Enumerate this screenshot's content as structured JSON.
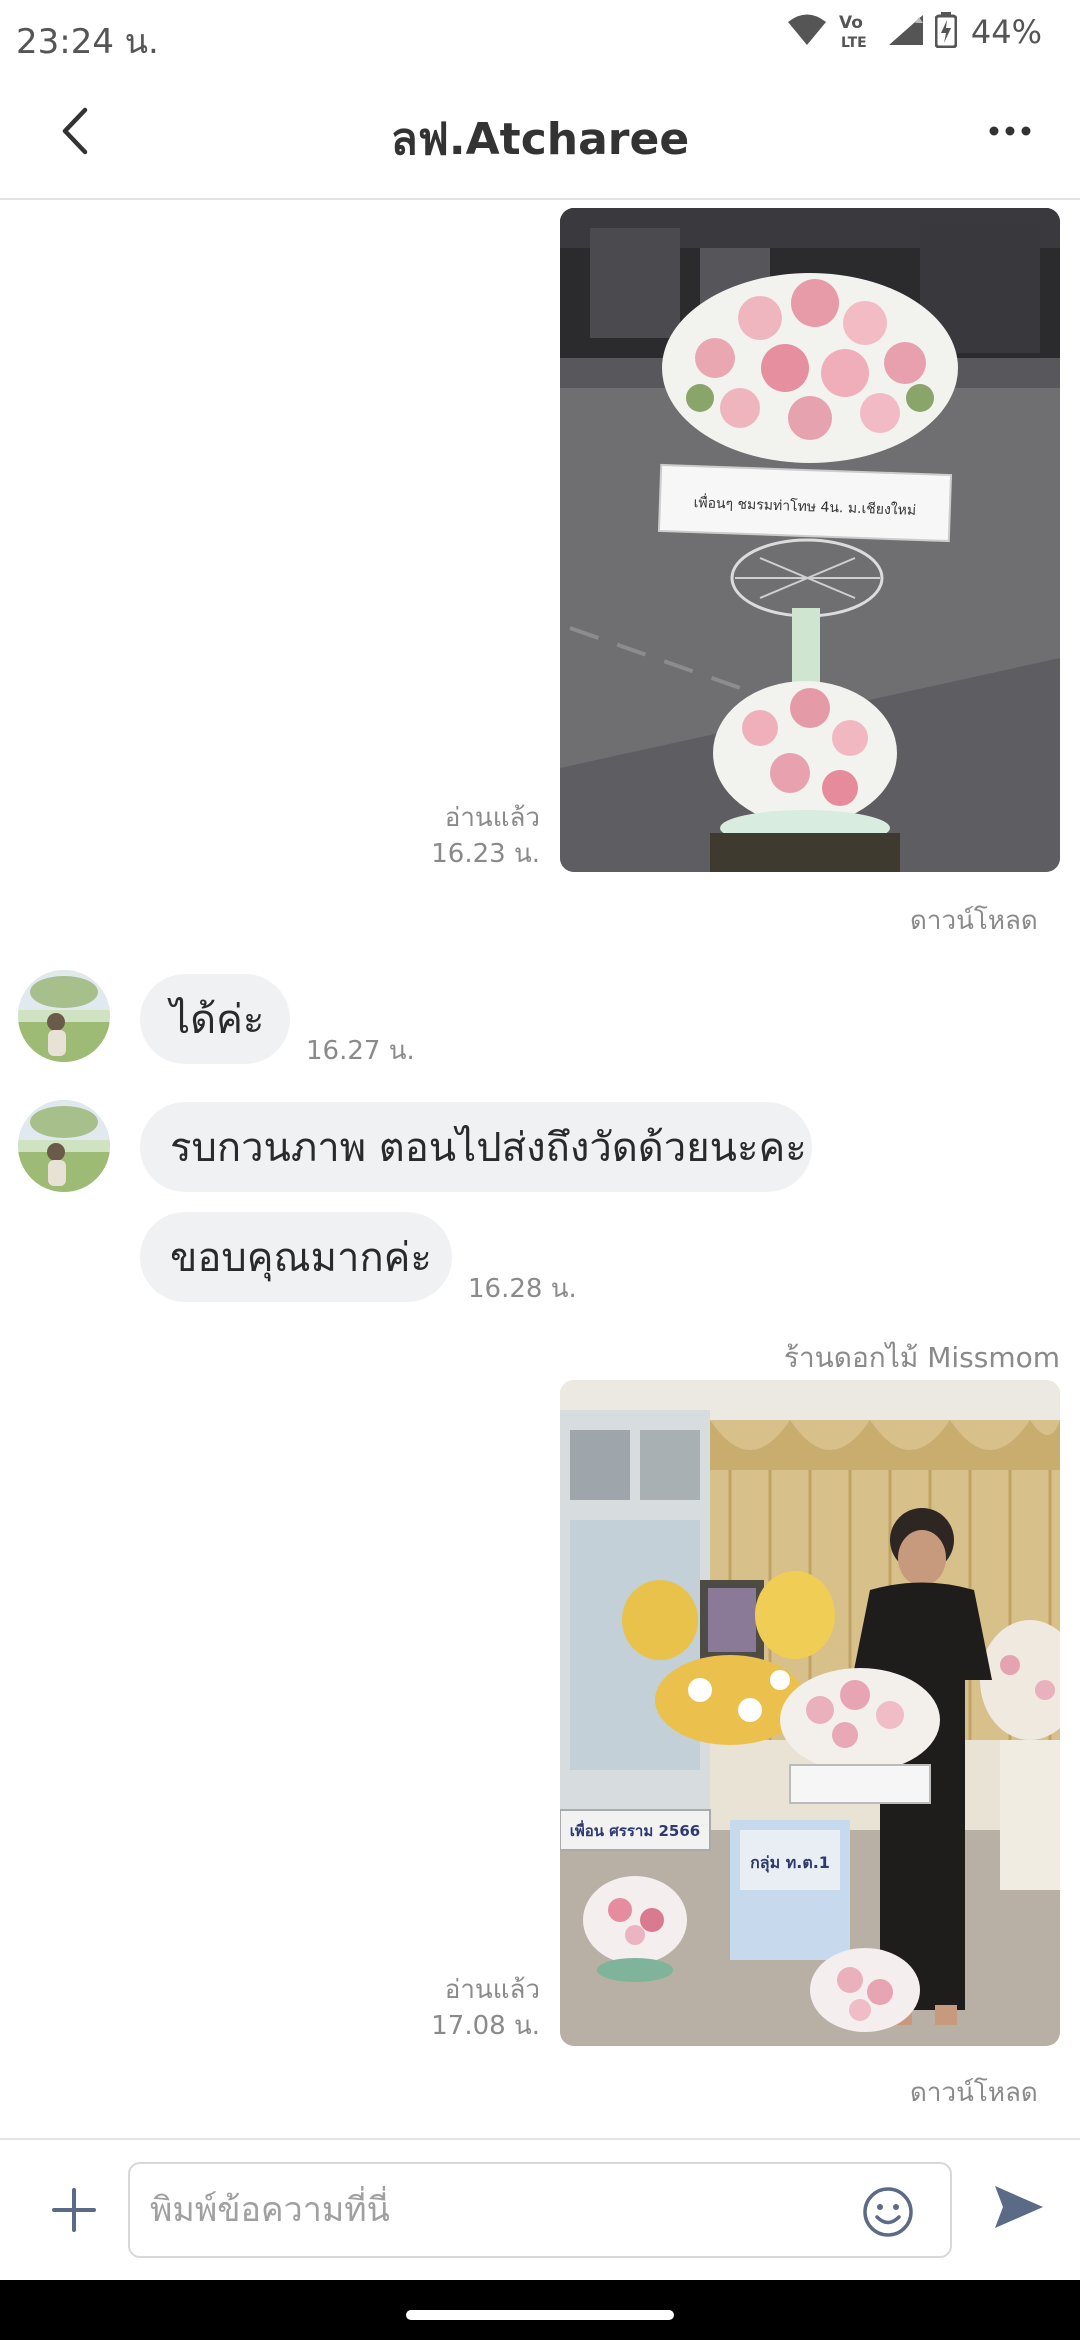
{
  "status_bar": {
    "time": "23:24 น.",
    "battery": "44%",
    "icons": [
      "wifi-icon",
      "volte-lte-icon",
      "cellular-signal-icon",
      "battery-charging-icon"
    ]
  },
  "header": {
    "title": "ลฟ.Atcharee",
    "back_icon": "chevron-left-icon",
    "more_icon": "more-horizontal-icon"
  },
  "messages": {
    "photo1": {
      "read_label": "อ่านแล้ว",
      "time": "16.23 น.",
      "download_label": "ดาวน์โหลด",
      "sign_text": "เพื่อนๆ ชมรมท่าโทษ 4น. ม.เชียงใหม่"
    },
    "bubble1": {
      "text": "ได้ค่ะ",
      "time": "16.27 น."
    },
    "bubble2": {
      "text": "รบกวนภาพ ตอนไปส่งถึงวัดด้วยนะคะ"
    },
    "bubble3": {
      "text": "ขอบคุณมากค่ะ",
      "time": "16.28 น."
    },
    "photo2": {
      "sender": "ร้านดอกไม้ Missmom",
      "read_label": "อ่านแล้ว",
      "time": "17.08 น.",
      "download_label": "ดาวน์โหลด",
      "sign_left": "เพื่อน ศรราม 2566",
      "sign_center": "กลุ่ม ท.ต.1"
    }
  },
  "input_bar": {
    "placeholder": "พิมพ์ข้อความที่นี่",
    "plus_icon": "plus-icon",
    "emoji_icon": "smiley-icon",
    "send_icon": "send-icon"
  },
  "colors": {
    "accent": "#5b6a86",
    "bubble": "#f0f1f3",
    "meta_text": "#8a8a8a"
  }
}
